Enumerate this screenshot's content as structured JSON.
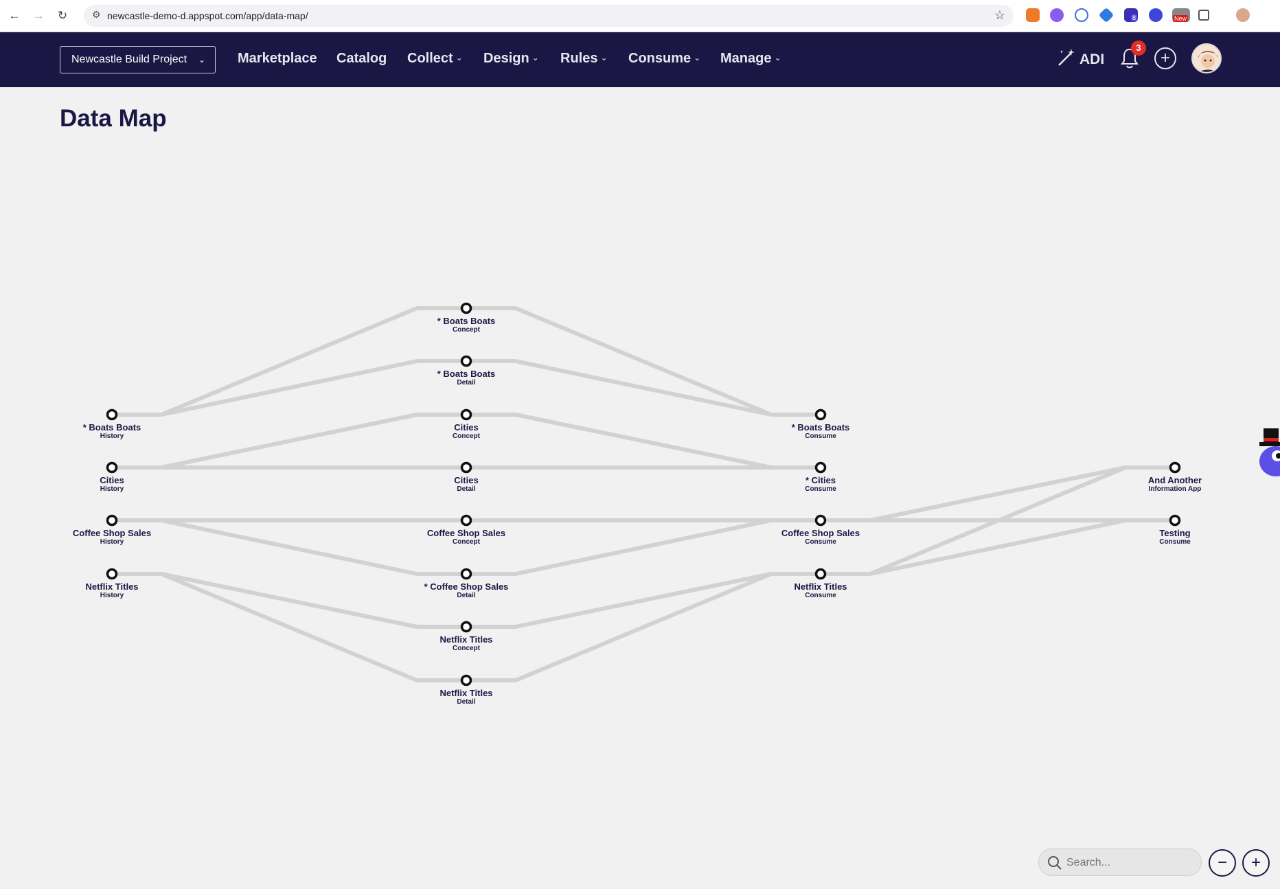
{
  "browser": {
    "url": "newcastle-demo-d.appspot.com/app/data-map/",
    "ext_new_badge": "New",
    "ext_count_badge": "8"
  },
  "header": {
    "project": "Newcastle Build Project",
    "nav": [
      {
        "label": "Marketplace",
        "has_menu": false
      },
      {
        "label": "Catalog",
        "has_menu": false
      },
      {
        "label": "Collect",
        "has_menu": true
      },
      {
        "label": "Design",
        "has_menu": true
      },
      {
        "label": "Rules",
        "has_menu": true
      },
      {
        "label": "Consume",
        "has_menu": true
      },
      {
        "label": "Manage",
        "has_menu": true
      }
    ],
    "adi_label": "ADI",
    "notification_count": "3"
  },
  "page": {
    "title": "Data Map"
  },
  "map": {
    "nodes": [
      {
        "id": "h1",
        "name": "* Boats Boats",
        "kind": "History"
      },
      {
        "id": "h2",
        "name": "Cities",
        "kind": "History"
      },
      {
        "id": "h3",
        "name": "Coffee Shop Sales",
        "kind": "History"
      },
      {
        "id": "h4",
        "name": "Netflix Titles",
        "kind": "History"
      },
      {
        "id": "m1",
        "name": "* Boats Boats",
        "kind": "Concept"
      },
      {
        "id": "m2",
        "name": "* Boats Boats",
        "kind": "Detail"
      },
      {
        "id": "m3",
        "name": "Cities",
        "kind": "Concept"
      },
      {
        "id": "m4",
        "name": "Cities",
        "kind": "Detail"
      },
      {
        "id": "m5",
        "name": "Coffee Shop Sales",
        "kind": "Concept"
      },
      {
        "id": "m6",
        "name": "* Coffee Shop Sales",
        "kind": "Detail"
      },
      {
        "id": "m7",
        "name": "Netflix Titles",
        "kind": "Concept"
      },
      {
        "id": "m8",
        "name": "Netflix Titles",
        "kind": "Detail"
      },
      {
        "id": "c1",
        "name": "* Boats Boats",
        "kind": "Consume"
      },
      {
        "id": "c2",
        "name": "* Cities",
        "kind": "Consume"
      },
      {
        "id": "c3",
        "name": "Coffee Shop Sales",
        "kind": "Consume"
      },
      {
        "id": "c4",
        "name": "Netflix Titles",
        "kind": "Consume"
      },
      {
        "id": "a1",
        "name": "And Another",
        "kind": "Information App"
      },
      {
        "id": "a2",
        "name": "Testing",
        "kind": "Consume"
      }
    ],
    "edges": [
      [
        "h1",
        "m1"
      ],
      [
        "h1",
        "m2"
      ],
      [
        "m1",
        "c1"
      ],
      [
        "m2",
        "c1"
      ],
      [
        "h2",
        "m3"
      ],
      [
        "h2",
        "m4"
      ],
      [
        "m3",
        "c2"
      ],
      [
        "m4",
        "c2"
      ],
      [
        "h3",
        "m5"
      ],
      [
        "h3",
        "m6"
      ],
      [
        "m5",
        "c3"
      ],
      [
        "m6",
        "c3"
      ],
      [
        "h4",
        "m7"
      ],
      [
        "h4",
        "m8"
      ],
      [
        "m7",
        "c4"
      ],
      [
        "m8",
        "c4"
      ],
      [
        "c3",
        "a1"
      ],
      [
        "c4",
        "a1"
      ],
      [
        "c3",
        "a2"
      ],
      [
        "c4",
        "a2"
      ]
    ]
  },
  "controls": {
    "search_placeholder": "Search...",
    "zoom_out": "−",
    "zoom_in": "+"
  }
}
